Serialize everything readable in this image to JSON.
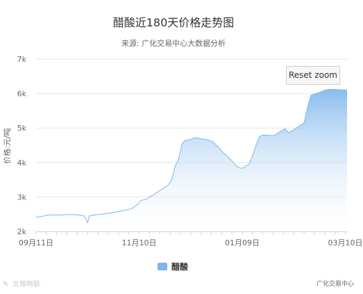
{
  "chart_data": {
    "type": "area",
    "title": "醋酸近180天价格走势图",
    "subtitle": "来源: 广化交易中心大数据分析",
    "ylabel": "价格:元/吨",
    "ylim": [
      2000,
      7000
    ],
    "y_ticks": [
      "2k",
      "3k",
      "4k",
      "5k",
      "6k",
      "7k"
    ],
    "x_tick_labels": [
      "09月11日",
      "11月10日",
      "01月09日",
      "03月10日"
    ],
    "grid": true,
    "legend_position": "bottom-center",
    "series": [
      {
        "name": "醋酸",
        "color": "#7cb5ec",
        "points": [
          [
            "09-11",
            2420
          ],
          [
            "09-14",
            2430
          ],
          [
            "09-17",
            2470
          ],
          [
            "09-20",
            2480
          ],
          [
            "09-23",
            2480
          ],
          [
            "09-26",
            2480
          ],
          [
            "09-29",
            2490
          ],
          [
            "10-03",
            2490
          ],
          [
            "10-06",
            2480
          ],
          [
            "10-09",
            2450
          ],
          [
            "10-11",
            2250
          ],
          [
            "10-12",
            2450
          ],
          [
            "10-15",
            2480
          ],
          [
            "10-19",
            2500
          ],
          [
            "10-23",
            2530
          ],
          [
            "10-27",
            2560
          ],
          [
            "10-31",
            2600
          ],
          [
            "11-03",
            2630
          ],
          [
            "11-06",
            2670
          ],
          [
            "11-09",
            2780
          ],
          [
            "11-11",
            2900
          ],
          [
            "11-14",
            2930
          ],
          [
            "11-16",
            3000
          ],
          [
            "11-18",
            3050
          ],
          [
            "11-21",
            3150
          ],
          [
            "11-24",
            3250
          ],
          [
            "11-27",
            3350
          ],
          [
            "11-29",
            3500
          ],
          [
            "12-01",
            3900
          ],
          [
            "12-03",
            4100
          ],
          [
            "12-05",
            4550
          ],
          [
            "12-07",
            4650
          ],
          [
            "12-10",
            4660
          ],
          [
            "12-12",
            4720
          ],
          [
            "12-14",
            4710
          ],
          [
            "12-17",
            4680
          ],
          [
            "12-20",
            4660
          ],
          [
            "12-23",
            4600
          ],
          [
            "12-25",
            4500
          ],
          [
            "12-27",
            4400
          ],
          [
            "12-29",
            4280
          ],
          [
            "12-31",
            4200
          ],
          [
            "01-03",
            4050
          ],
          [
            "01-05",
            3920
          ],
          [
            "01-07",
            3850
          ],
          [
            "01-09",
            3830
          ],
          [
            "01-11",
            3900
          ],
          [
            "01-13",
            3950
          ],
          [
            "01-15",
            4200
          ],
          [
            "01-17",
            4500
          ],
          [
            "01-19",
            4750
          ],
          [
            "01-21",
            4800
          ],
          [
            "01-24",
            4790
          ],
          [
            "01-27",
            4770
          ],
          [
            "01-29",
            4820
          ],
          [
            "01-31",
            4900
          ],
          [
            "02-03",
            4980
          ],
          [
            "02-05",
            4860
          ],
          [
            "02-08",
            4950
          ],
          [
            "02-11",
            5050
          ],
          [
            "02-14",
            5150
          ],
          [
            "02-16",
            5600
          ],
          [
            "02-18",
            5950
          ],
          [
            "02-21",
            6000
          ],
          [
            "02-24",
            6050
          ],
          [
            "02-26",
            6100
          ],
          [
            "03-01",
            6120
          ],
          [
            "03-04",
            6120
          ],
          [
            "03-07",
            6110
          ],
          [
            "03-11",
            6100
          ]
        ]
      }
    ],
    "credits": "广化交易中心"
  },
  "ui": {
    "reset_zoom_label": "Reset zoom",
    "watermark": "文殊物联"
  },
  "colors": {
    "area_top": "#7cb5ec",
    "area_bottom": "#ffffff",
    "line": "#7cb5ec",
    "grid": "#e6e6e6"
  }
}
